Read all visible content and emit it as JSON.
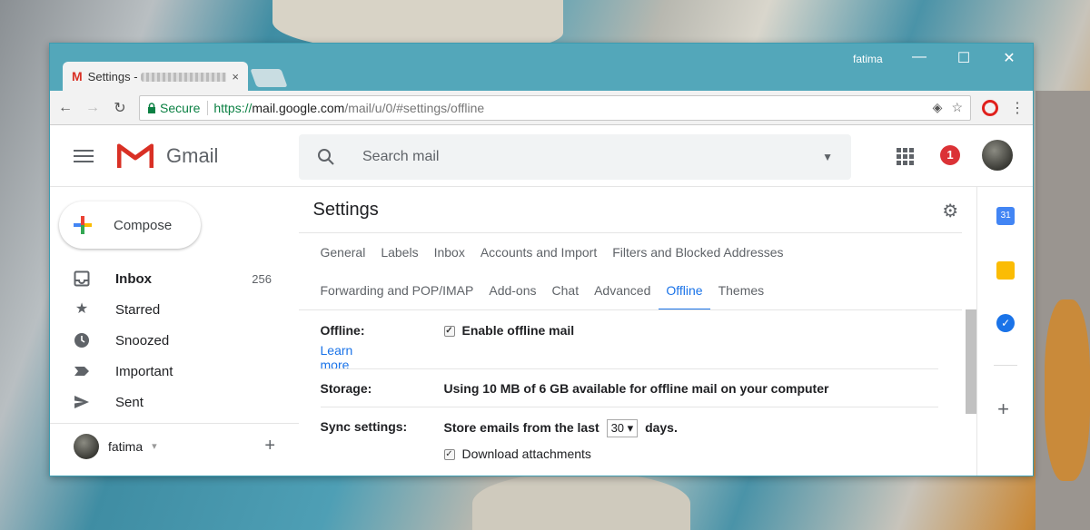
{
  "browser": {
    "tab_title": "Settings - ",
    "tab_close": "×",
    "window_user": "fatima",
    "controls": {
      "minimize": "—",
      "maximize": "☐",
      "close": "✕"
    },
    "secure_label": "Secure",
    "url_scheme": "https://",
    "url_host": "mail.google.com",
    "url_path": "/mail/u/0/#settings/offline"
  },
  "gmail": {
    "brand": "Gmail",
    "search_placeholder": "Search mail",
    "notification_count": "1",
    "compose_label": "Compose",
    "nav": [
      {
        "label": "Inbox",
        "count": "256"
      },
      {
        "label": "Starred"
      },
      {
        "label": "Snoozed"
      },
      {
        "label": "Important"
      },
      {
        "label": "Sent"
      }
    ],
    "hangouts_user": "fatima",
    "hangouts_caret": "▾"
  },
  "settings": {
    "title": "Settings",
    "tabs_row1": [
      "General",
      "Labels",
      "Inbox",
      "Accounts and Import",
      "Filters and Blocked Addresses"
    ],
    "tabs_row2": [
      "Forwarding and POP/IMAP",
      "Add-ons",
      "Chat",
      "Advanced",
      "Offline",
      "Themes"
    ],
    "active_tab": "Offline",
    "offline": {
      "label": "Offline:",
      "option": "Enable offline mail",
      "learn_more": "Learn more",
      "checked": true
    },
    "storage": {
      "label": "Storage:",
      "value": "Using 10 MB of 6 GB available for offline mail on your computer"
    },
    "sync": {
      "label": "Sync settings:",
      "prefix": "Store emails from the last",
      "days_value": "30",
      "suffix": "days.",
      "attachments": "Download attachments",
      "attachments_checked": true
    }
  },
  "colors": {
    "accent": "#1a73e8",
    "gmail_red": "#d93025",
    "secure_green": "#0b8043",
    "titlebar": "#53a7ba"
  }
}
